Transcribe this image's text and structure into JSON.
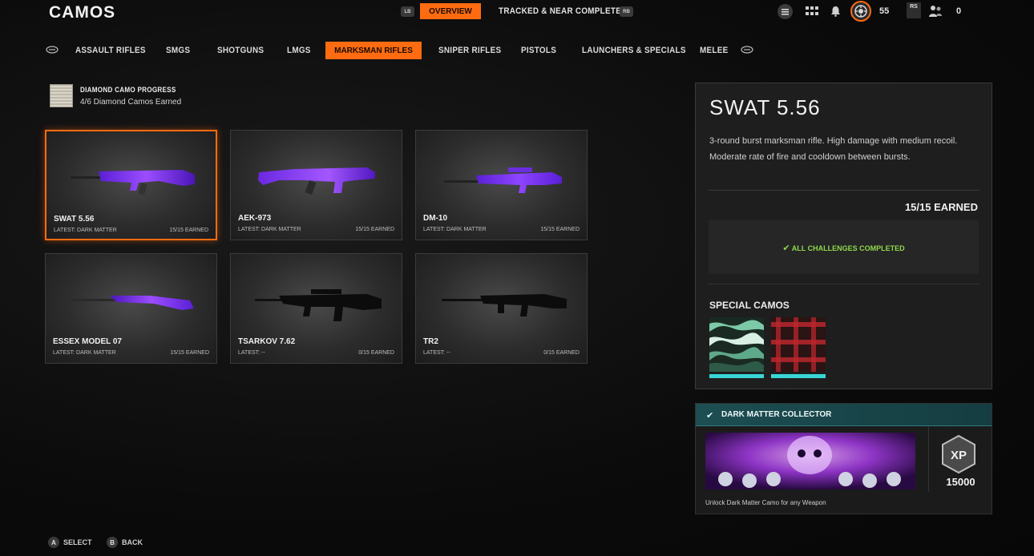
{
  "header": {
    "title": "CAMOS",
    "lb_label": "LB",
    "rb_label": "RB",
    "tabs": [
      {
        "label": "OVERVIEW",
        "active": true
      },
      {
        "label": "TRACKED & NEAR COMPLETE",
        "active": false
      }
    ],
    "currency_value": "55",
    "rs_label": "RS",
    "party_count": "0",
    "icons": [
      "menu-icon",
      "grid-icon",
      "bell-icon",
      "currency-icon",
      "party-icon"
    ]
  },
  "categories": [
    {
      "label": "ASSAULT RIFLES",
      "active": false
    },
    {
      "label": "SMGS",
      "active": false
    },
    {
      "label": "SHOTGUNS",
      "active": false
    },
    {
      "label": "LMGS",
      "active": false
    },
    {
      "label": "MARKSMAN RIFLES",
      "active": true
    },
    {
      "label": "SNIPER RIFLES",
      "active": false
    },
    {
      "label": "PISTOLS",
      "active": false
    },
    {
      "label": "LAUNCHERS & SPECIALS",
      "active": false
    },
    {
      "label": "MELEE",
      "active": false
    }
  ],
  "progress": {
    "title": "DIAMOND CAMO PROGRESS",
    "subtitle": "4/6 Diamond Camos Earned"
  },
  "weapons": [
    {
      "name": "SWAT 5.56",
      "latest": "LATEST: DARK MATTER",
      "earned": "15/15 EARNED",
      "selected": true,
      "camo": "dark-matter"
    },
    {
      "name": "AEK-973",
      "latest": "LATEST: DARK MATTER",
      "earned": "15/15 EARNED",
      "selected": false,
      "camo": "dark-matter"
    },
    {
      "name": "DM-10",
      "latest": "LATEST: DARK MATTER",
      "earned": "15/15 EARNED",
      "selected": false,
      "camo": "dark-matter"
    },
    {
      "name": "ESSEX MODEL 07",
      "latest": "LATEST: DARK MATTER",
      "earned": "15/15 EARNED",
      "selected": false,
      "camo": "dark-matter"
    },
    {
      "name": "TSARKOV 7.62",
      "latest": "LATEST: --",
      "earned": "0/15 EARNED",
      "selected": false,
      "camo": "none"
    },
    {
      "name": "TR2",
      "latest": "LATEST: --",
      "earned": "0/15 EARNED",
      "selected": false,
      "camo": "none"
    }
  ],
  "detail": {
    "name": "SWAT 5.56",
    "description": "3-round burst marksman rifle.  High damage with medium recoil. Moderate rate of fire and cooldown between bursts.",
    "earned": "15/15 EARNED",
    "challenge_status": "ALL CHALLENGES COMPLETED",
    "special_title": "SPECIAL CAMOS",
    "special_camos": [
      "glitch-camo",
      "red-plaid-camo"
    ]
  },
  "achievement": {
    "title": "DARK MATTER COLLECTOR",
    "xp_label": "XP",
    "xp_value": "15000",
    "description": "Unlock Dark Matter Camo for any Weapon"
  },
  "footer": [
    {
      "button": "A",
      "label": "SELECT"
    },
    {
      "button": "B",
      "label": "BACK"
    }
  ],
  "colors": {
    "accent": "#ff6b11",
    "success": "#8fd94a",
    "achievement_header": "#1d4e52",
    "dark_matter": "#7a2cff"
  }
}
